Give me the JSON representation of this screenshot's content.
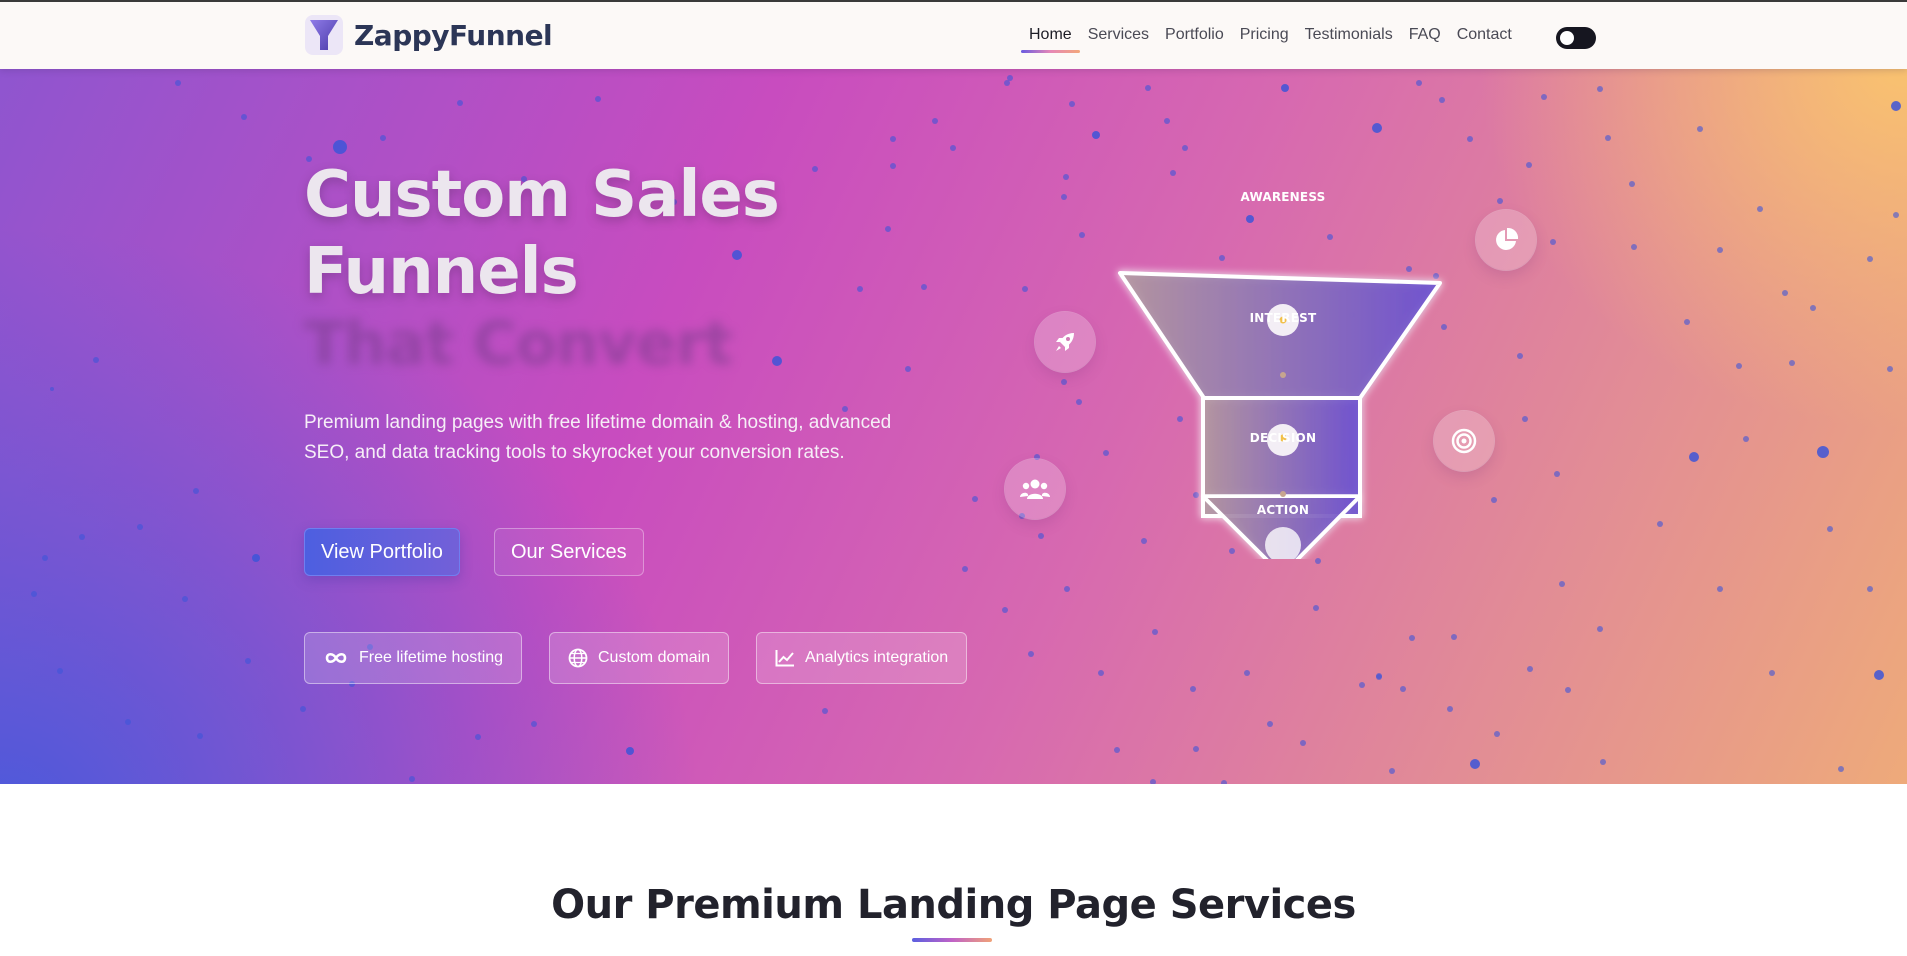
{
  "navbar": {
    "brand": "ZappyFunnel",
    "links": [
      {
        "label": "Home",
        "active": true
      },
      {
        "label": "Services"
      },
      {
        "label": "Portfolio"
      },
      {
        "label": "Pricing"
      },
      {
        "label": "Testimonials"
      },
      {
        "label": "FAQ"
      },
      {
        "label": "Contact"
      }
    ],
    "theme_toggle": "dark-mode-toggle"
  },
  "hero": {
    "title_line1": "Custom Sales",
    "title_line2": "Funnels",
    "title_line3": "That Convert",
    "description": "Premium landing pages with free lifetime domain & hosting, advanced SEO, and data tracking tools to skyrocket your conversion rates.",
    "primary_button": "View Portfolio",
    "secondary_button": "Our Services",
    "features": [
      {
        "label": "Free lifetime hosting",
        "icon": "infinity-icon"
      },
      {
        "label": "Custom domain",
        "icon": "globe-icon"
      },
      {
        "label": "Analytics integration",
        "icon": "chart-line-icon"
      }
    ],
    "funnel_stages": [
      "AWARENESS",
      "INTEREST",
      "DECISION",
      "ACTION"
    ],
    "floating_icons": [
      "rocket-icon",
      "pie-chart-icon",
      "target-icon",
      "users-icon"
    ]
  },
  "services": {
    "title": "Our Premium Landing Page Services"
  },
  "colors": {
    "brand_dark": "#2c3657",
    "primary": "#4d5fe0",
    "hero_pink": "#c84cbf",
    "hero_orange": "#f6c06f",
    "dot_blue": "#3d55d8"
  }
}
